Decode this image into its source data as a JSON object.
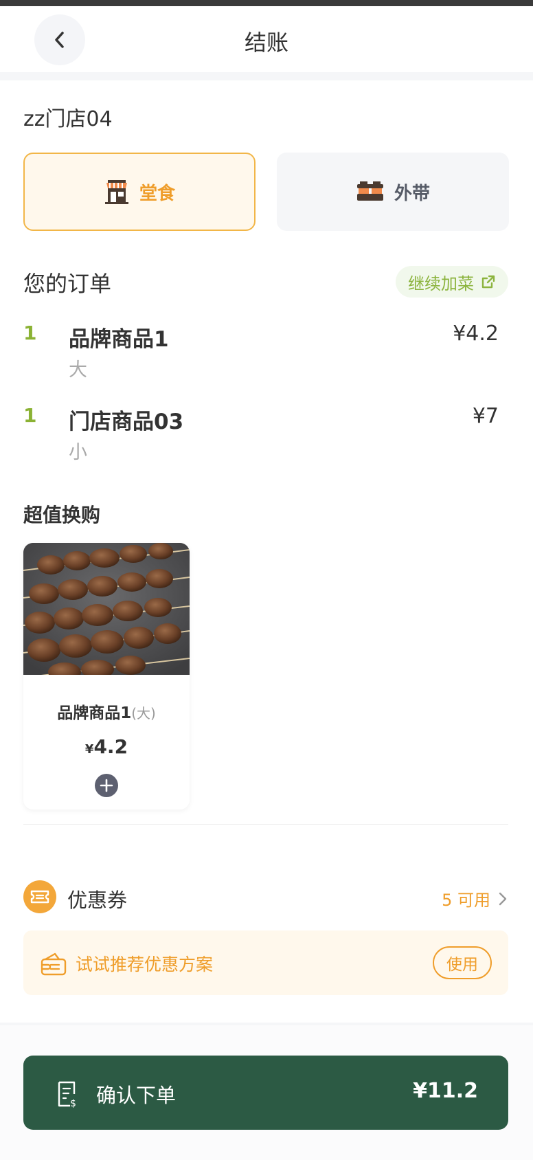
{
  "header": {
    "title": "结账",
    "back_icon": "chevron-left-icon"
  },
  "store": {
    "name": "zz门店04"
  },
  "dining_mode": {
    "options": [
      {
        "label": "堂食",
        "icon": "storefront-icon",
        "selected": true
      },
      {
        "label": "外带",
        "icon": "takeout-cups-icon",
        "selected": false
      }
    ]
  },
  "order": {
    "title": "您的订单",
    "add_more_label": "继续加菜",
    "items": [
      {
        "qty": "1",
        "name": "品牌商品1",
        "spec": "大",
        "price": "¥4.2"
      },
      {
        "qty": "1",
        "name": "门店商品03",
        "spec": "小",
        "price": "¥7"
      }
    ]
  },
  "deals": {
    "title": "超值换购",
    "items": [
      {
        "name": "品牌商品1",
        "spec": "(大)",
        "currency": "¥",
        "price": "4.2"
      }
    ]
  },
  "coupon": {
    "label": "优惠券",
    "count_text": "5 可用",
    "recommend_text": "试试推荐优惠方案",
    "use_label": "使用"
  },
  "footer": {
    "submit_label": "确认下单",
    "total": "¥11.2"
  },
  "colors": {
    "accent_orange": "#ef9d2a",
    "accent_green": "#8bb234",
    "submit_bg": "#2c5a44"
  }
}
